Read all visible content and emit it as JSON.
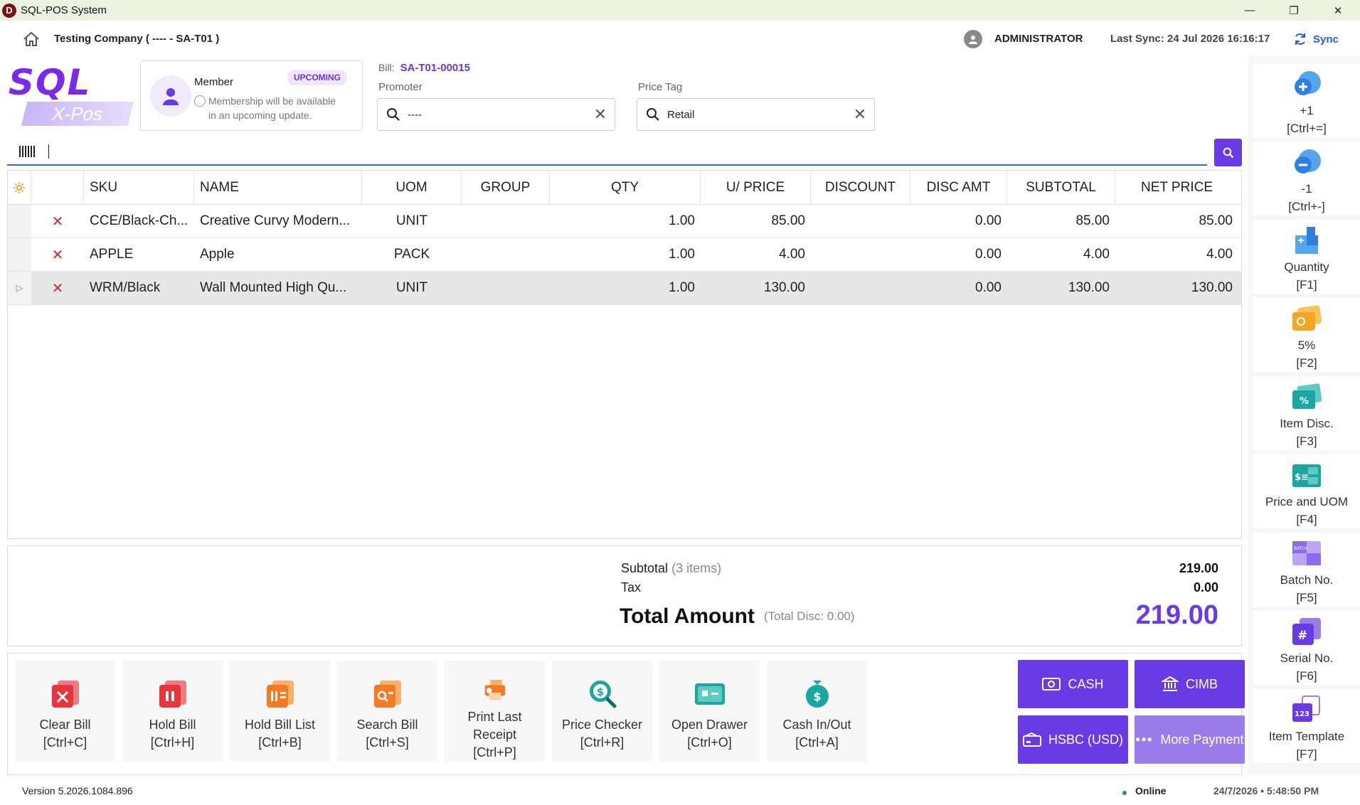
{
  "window": {
    "title": "SQL-POS System",
    "minimize": "—",
    "restore": "❐",
    "close": "✕"
  },
  "header": {
    "company": "Testing Company ( ---- - SA-T01 )",
    "user": "ADMINISTRATOR",
    "last_sync": "Last Sync: 24 Jul 2026 16:16:17",
    "sync_label": "Sync"
  },
  "logo": {
    "top": "SQL",
    "bottom": "X-Pos"
  },
  "member": {
    "title": "Member",
    "badge": "UPCOMING",
    "note_line1": "Membership will be available",
    "note_line2": "in an upcoming update."
  },
  "bill": {
    "label": "Bill:",
    "number": "SA-T01-00015"
  },
  "promoter": {
    "label": "Promoter",
    "value": "----"
  },
  "price_tag": {
    "label": "Price Tag",
    "value": "Retail"
  },
  "grid": {
    "columns": [
      "SKU",
      "NAME",
      "UOM",
      "GROUP",
      "QTY",
      "U/ PRICE",
      "DISCOUNT",
      "DISC AMT",
      "SUBTOTAL",
      "NET PRICE"
    ],
    "rows": [
      {
        "sku": "CCE/Black-Ch...",
        "name": "Creative Curvy Modern...",
        "uom": "UNIT",
        "group": "",
        "qty": "1.00",
        "price": "85.00",
        "discount": "",
        "disc_amt": "0.00",
        "subtotal": "85.00",
        "net": "85.00"
      },
      {
        "sku": "APPLE",
        "name": "Apple",
        "uom": "PACK",
        "group": "",
        "qty": "1.00",
        "price": "4.00",
        "discount": "",
        "disc_amt": "0.00",
        "subtotal": "4.00",
        "net": "4.00"
      },
      {
        "sku": "WRM/Black",
        "name": "Wall Mounted High Qu...",
        "uom": "UNIT",
        "group": "",
        "qty": "1.00",
        "price": "130.00",
        "discount": "",
        "disc_amt": "0.00",
        "subtotal": "130.00",
        "net": "130.00"
      }
    ],
    "delete_glyph": "✕",
    "current_row_glyph": "▷"
  },
  "totals": {
    "subtotal_label": "Subtotal",
    "subtotal_items": "(3 items)",
    "subtotal": "219.00",
    "tax_label": "Tax",
    "tax": "0.00",
    "total_label": "Total Amount",
    "total_disc": "(Total Disc: 0.00)",
    "total": "219.00"
  },
  "actions": [
    {
      "label": "Clear Bill",
      "key": "[Ctrl+C]",
      "icon": "clear-bill-icon",
      "color": "#e8343d"
    },
    {
      "label": "Hold Bill",
      "key": "[Ctrl+H]",
      "icon": "hold-bill-icon",
      "color": "#e8343d"
    },
    {
      "label": "Hold Bill List",
      "key": "[Ctrl+B]",
      "icon": "hold-bill-list-icon",
      "color": "#f57a24"
    },
    {
      "label": "Search Bill",
      "key": "[Ctrl+S]",
      "icon": "search-bill-icon",
      "color": "#f57a24"
    },
    {
      "label": "Print Last Receipt",
      "key": "[Ctrl+P]",
      "icon": "print-receipt-icon",
      "color": "#f57a24"
    },
    {
      "label": "Price Checker",
      "key": "[Ctrl+R]",
      "icon": "price-checker-icon",
      "color": "#1aa6a1"
    },
    {
      "label": "Open Drawer",
      "key": "[Ctrl+O]",
      "icon": "open-drawer-icon",
      "color": "#1aa6a1"
    },
    {
      "label": "Cash In/Out",
      "key": "[Ctrl+A]",
      "icon": "cash-in-out-icon",
      "color": "#1aa6a1"
    }
  ],
  "payments": [
    {
      "label": "CASH",
      "icon": "cash-icon"
    },
    {
      "label": "CIMB",
      "icon": "bank-icon"
    },
    {
      "label": "HSBC (USD)",
      "icon": "card-icon"
    },
    {
      "label": "More Payment",
      "icon": "more-icon"
    }
  ],
  "quick": [
    {
      "label": "+1",
      "key": "[Ctrl+=]",
      "icon": "plus-one-icon",
      "color": "#2f7fe0"
    },
    {
      "label": "-1",
      "key": "[Ctrl+-]",
      "icon": "minus-one-icon",
      "color": "#2f7fe0"
    },
    {
      "label": "Quantity",
      "key": "[F1]",
      "icon": "quantity-icon",
      "color": "#2f7fe0"
    },
    {
      "label": "5%",
      "key": "[F2]",
      "icon": "discount-5-icon",
      "color": "#f5a524"
    },
    {
      "label": "Item Disc.",
      "key": "[F3]",
      "icon": "item-discount-icon",
      "color": "#1aa6a1"
    },
    {
      "label": "Price and UOM",
      "key": "[F4]",
      "icon": "price-uom-icon",
      "color": "#1aa6a1"
    },
    {
      "label": "Batch No.",
      "key": "[F5]",
      "icon": "batch-icon",
      "color": "#8b6bf0"
    },
    {
      "label": "Serial No.",
      "key": "[F6]",
      "icon": "serial-icon",
      "color": "#6a3be4"
    },
    {
      "label": "Item Template",
      "key": "[F7]",
      "icon": "template-icon",
      "color": "#6a3be4"
    }
  ],
  "status": {
    "version": "Version 5.2026.1084.896",
    "online": "Online",
    "datetime": "24/7/2026  •  5:48:50 PM"
  }
}
